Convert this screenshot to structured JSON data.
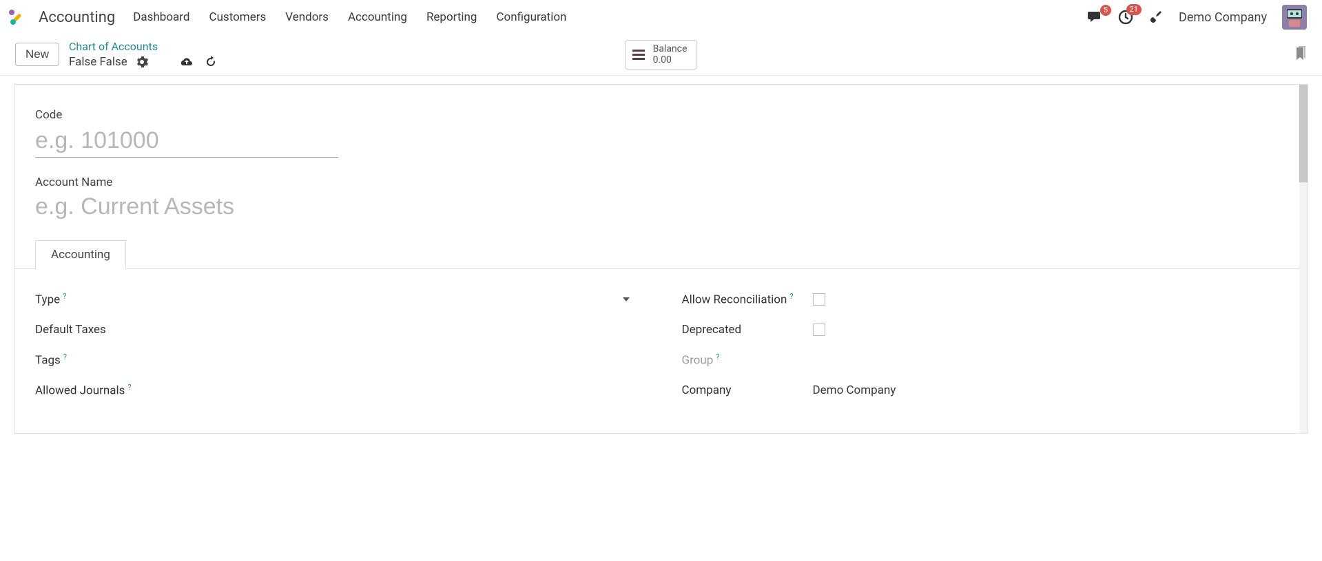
{
  "navbar": {
    "app_name": "Accounting",
    "items": [
      "Dashboard",
      "Customers",
      "Vendors",
      "Accounting",
      "Reporting",
      "Configuration"
    ],
    "messages_badge": "5",
    "activities_badge": "21",
    "company": "Demo Company"
  },
  "control": {
    "new_label": "New",
    "breadcrumb_parent": "Chart of Accounts",
    "breadcrumb_current": "False False",
    "stat_label": "Balance",
    "stat_value": "0.00"
  },
  "form": {
    "code_label": "Code",
    "code_placeholder": "e.g. 101000",
    "name_label": "Account Name",
    "name_placeholder": "e.g. Current Assets",
    "tab_label": "Accounting",
    "left_rows": {
      "type": "Type",
      "default_taxes": "Default Taxes",
      "tags": "Tags",
      "allowed_journals": "Allowed Journals"
    },
    "right_rows": {
      "allow_reconciliation": "Allow Reconciliation",
      "deprecated": "Deprecated",
      "group": "Group",
      "company": "Company",
      "company_value": "Demo Company"
    },
    "help_char": "?"
  }
}
